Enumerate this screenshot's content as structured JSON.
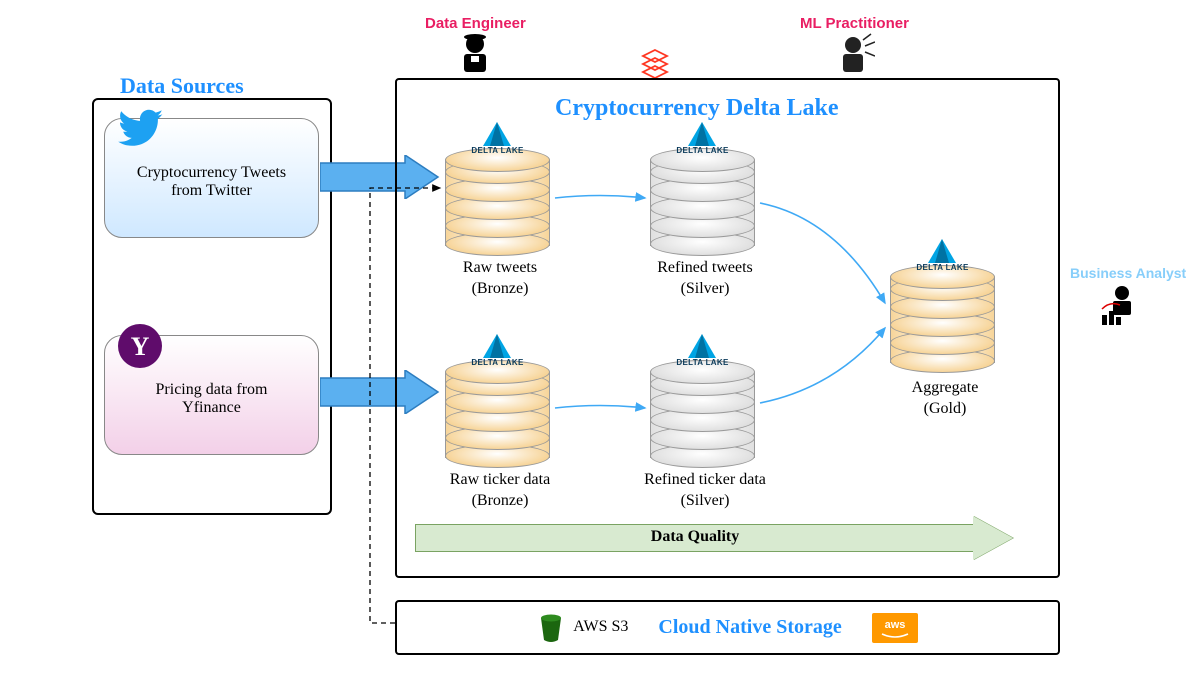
{
  "sources": {
    "title": "Data Sources",
    "twitter": {
      "label": "Cryptocurrency Tweets\nfrom Twitter",
      "icon": "twitter-bird"
    },
    "yahoo": {
      "label": "Pricing data from\nYfinance",
      "icon": "yahoo-y"
    }
  },
  "personas": {
    "data_engineer": "Data Engineer",
    "ml_practitioner": "ML Practitioner",
    "business_analyst": "Business Analyst"
  },
  "lake": {
    "title": "Cryptocurrency Delta Lake",
    "logo": "databricks",
    "nodes": {
      "raw_tweets": {
        "label": "Raw tweets",
        "tier": "(Bronze)"
      },
      "refined_tweets": {
        "label": "Refined tweets",
        "tier": "(Silver)"
      },
      "raw_ticker": {
        "label": "Raw ticker data",
        "tier": "(Bronze)"
      },
      "refined_ticker": {
        "label": "Refined ticker data",
        "tier": "(Silver)"
      },
      "aggregate": {
        "label": "Aggregate",
        "tier": "(Gold)"
      }
    },
    "node_logo_text": "DELTA LAKE",
    "data_quality": "Data Quality"
  },
  "cloud": {
    "title": "Cloud Native Storage",
    "s3_label": "AWS S3",
    "aws_logo": "aws"
  },
  "colors": {
    "blue_title": "#1e90ff",
    "pink": "#e91e63",
    "light_blue": "#87cefa",
    "arrow_blue": "#5bb0f0",
    "flow_line": "#3fa9f5"
  }
}
